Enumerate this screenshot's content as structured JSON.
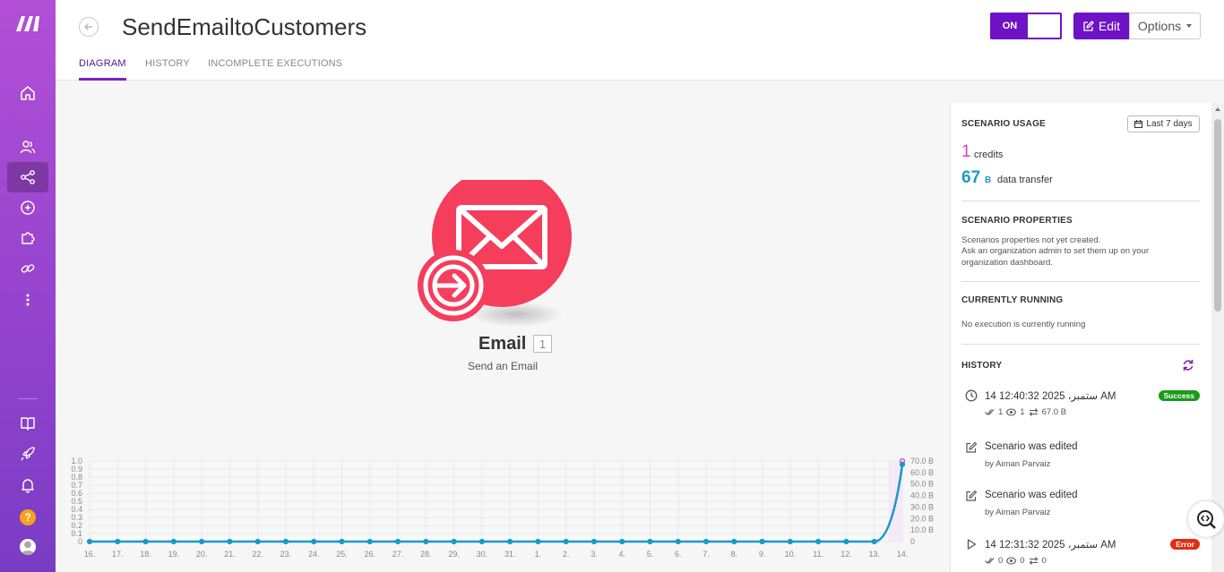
{
  "header": {
    "title": "SendEmailtoCustomers",
    "tabs": [
      {
        "label": "DIAGRAM",
        "active": true
      },
      {
        "label": "HISTORY",
        "active": false
      },
      {
        "label": "INCOMPLETE EXECUTIONS",
        "active": false
      }
    ],
    "toggle_label": "ON",
    "edit_label": "Edit",
    "options_label": "Options"
  },
  "module": {
    "name": "Email",
    "number": "1",
    "subtitle": "Send an Email",
    "color": "#f53d5c"
  },
  "chart_data": {
    "type": "line",
    "categories": [
      "16.",
      "17.",
      "18.",
      "19.",
      "20.",
      "21.",
      "22.",
      "23.",
      "24.",
      "25.",
      "26.",
      "27.",
      "28.",
      "29.",
      "30.",
      "31.",
      "1.",
      "2.",
      "3.",
      "4.",
      "5.",
      "6.",
      "7.",
      "8.",
      "9.",
      "10.",
      "11.",
      "12.",
      "13.",
      "14."
    ],
    "series": [
      {
        "values": [
          0,
          0,
          0,
          0,
          0,
          0,
          0,
          0,
          0,
          0,
          0,
          0,
          0,
          0,
          0,
          0,
          0,
          0,
          0,
          0,
          0,
          0,
          0,
          0,
          0,
          0,
          0,
          0,
          0,
          1
        ],
        "color": "#e03bd4",
        "axis": "left"
      },
      {
        "values": [
          0,
          0,
          0,
          0,
          0,
          0,
          0,
          0,
          0,
          0,
          0,
          0,
          0,
          0,
          0,
          0,
          0,
          0,
          0,
          0,
          0,
          0,
          0,
          0,
          0,
          0,
          0,
          0,
          0,
          67
        ],
        "color": "#1b9ac7",
        "axis": "right"
      }
    ],
    "y_left": {
      "range": [
        0,
        1.0
      ],
      "ticks": [
        "1.0",
        "0.9",
        "0.8",
        "0.7",
        "0.6",
        "0.5",
        "0.4",
        "0.3",
        "0.2",
        "0.1",
        "0"
      ]
    },
    "y_right": {
      "range": [
        0,
        70
      ],
      "ticks": [
        "70.0 B",
        "60.0 B",
        "50.0 B",
        "40.0 B",
        "30.0 B",
        "20.0 B",
        "10.0 B",
        "0"
      ]
    },
    "grid": true
  },
  "panel": {
    "usage_title": "SCENARIO USAGE",
    "range_label": "Last 7 days",
    "credits_value": "1",
    "credits_label": "credits",
    "data_value": "67",
    "data_unit": "B",
    "data_label": "data transfer",
    "properties_title": "SCENARIO PROPERTIES",
    "properties_text1": "Scenarios properties not yet created.",
    "properties_text2": "Ask an organization admin to set them up on your",
    "properties_text3": "organization dashboard.",
    "running_title": "CURRENTLY RUNNING",
    "running_text": "No execution is currently running",
    "history_title": "HISTORY",
    "history": [
      {
        "title": "14 ستمبر، 2025 12:40:32 AM",
        "badge": "Success",
        "stats": [
          "1",
          "1",
          "67.0 B"
        ]
      },
      {
        "title": "Scenario was edited",
        "sub": "by Aiman Parvaiz"
      },
      {
        "title": "Scenario was edited",
        "sub": "by Aiman Parvaiz"
      },
      {
        "title": "14 ستمبر، 2025 12:31:32 AM",
        "badge": "Error",
        "stats": [
          "0",
          "0",
          "0"
        ]
      }
    ]
  },
  "colors": {
    "brand": "#6d12c4",
    "credits": "#e03bd4",
    "transfer": "#1b9ac7",
    "success": "#1a9a1a",
    "error": "#e12d12"
  }
}
